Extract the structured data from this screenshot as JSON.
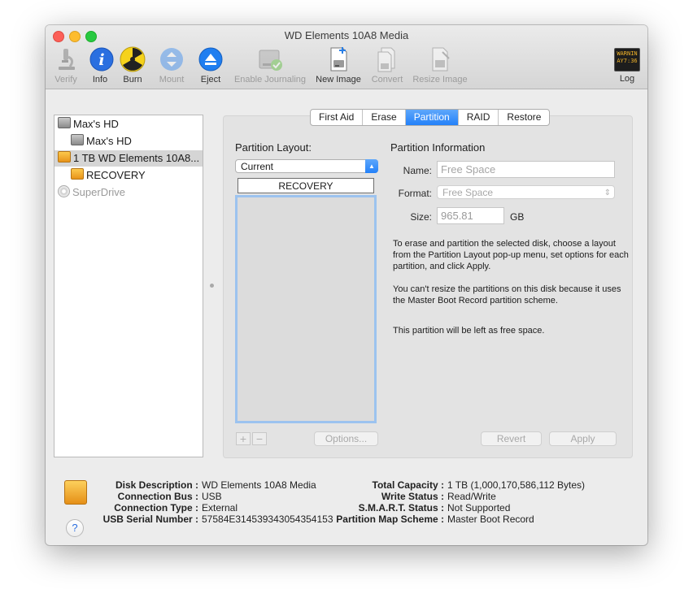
{
  "window": {
    "title": "WD Elements 10A8 Media"
  },
  "toolbar": {
    "items": [
      {
        "label": "Verify",
        "enabled": false
      },
      {
        "label": "Info",
        "enabled": true
      },
      {
        "label": "Burn",
        "enabled": true
      },
      {
        "label": "Mount",
        "enabled": false
      },
      {
        "label": "Eject",
        "enabled": true
      },
      {
        "label": "Enable Journaling",
        "enabled": false
      },
      {
        "label": "New Image",
        "enabled": true
      },
      {
        "label": "Convert",
        "enabled": false
      },
      {
        "label": "Resize Image",
        "enabled": false
      },
      {
        "label": "Log",
        "enabled": true
      }
    ],
    "log_icon_text": [
      "WARNIN",
      "AY7:36"
    ]
  },
  "sidebar": {
    "items": [
      {
        "label": "Max's HD",
        "icon": "internal-disk-icon",
        "selected": false
      },
      {
        "label": "Max's HD",
        "icon": "volume-icon",
        "selected": false
      },
      {
        "label": "1 TB WD Elements 10A8...",
        "icon": "external-disk-icon",
        "selected": true
      },
      {
        "label": "RECOVERY",
        "icon": "external-volume-icon",
        "selected": false
      },
      {
        "label": "SuperDrive",
        "icon": "optical-drive-icon",
        "selected": false
      }
    ]
  },
  "tabs": [
    {
      "label": "First Aid",
      "active": false
    },
    {
      "label": "Erase",
      "active": false
    },
    {
      "label": "Partition",
      "active": true
    },
    {
      "label": "RAID",
      "active": false
    },
    {
      "label": "Restore",
      "active": false
    }
  ],
  "partition": {
    "layout_label": "Partition Layout:",
    "layout_value": "Current",
    "partitions": [
      "RECOVERY"
    ],
    "plus": "+",
    "minus": "−",
    "options_label": "Options...",
    "info_title": "Partition Information",
    "name_label": "Name:",
    "name_placeholder": "Free Space",
    "format_label": "Format:",
    "format_value": "Free Space",
    "size_label": "Size:",
    "size_value": "965.81",
    "size_unit": "GB",
    "help_text_1": "To erase and partition the selected disk, choose a layout from the Partition Layout pop-up menu, set options for each partition, and click Apply.",
    "help_text_2": "You can't resize the partitions on this disk because it uses the Master Boot Record partition scheme.",
    "help_text_3": "This partition will be left as free space.",
    "revert_label": "Revert",
    "apply_label": "Apply"
  },
  "details": {
    "left": [
      {
        "key": "Disk Description :",
        "value": "WD Elements 10A8 Media"
      },
      {
        "key": "Connection Bus :",
        "value": "USB"
      },
      {
        "key": "Connection Type :",
        "value": "External"
      },
      {
        "key": "USB Serial Number :",
        "value": "57584E314539343054354153"
      }
    ],
    "right": [
      {
        "key": "Total Capacity :",
        "value": "1 TB (1,000,170,586,112 Bytes)"
      },
      {
        "key": "Write Status :",
        "value": "Read/Write"
      },
      {
        "key": "S.M.A.R.T. Status :",
        "value": "Not Supported"
      },
      {
        "key": "Partition Map Scheme :",
        "value": "Master Boot Record"
      }
    ],
    "help_glyph": "?"
  }
}
